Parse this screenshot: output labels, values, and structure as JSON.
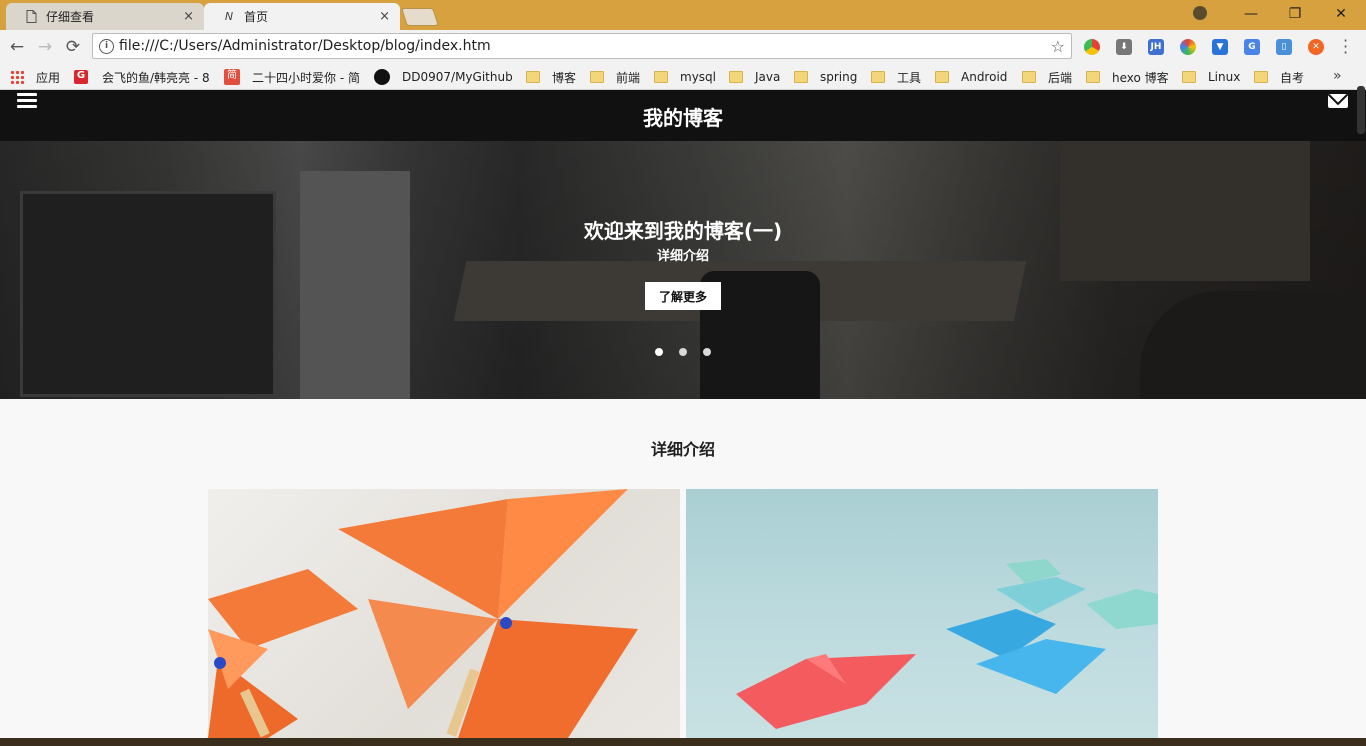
{
  "browser": {
    "tabs": [
      {
        "title": "仔细查看",
        "icon": "page-icon",
        "active": false
      },
      {
        "title": "首页",
        "icon": "n-logo-icon",
        "favicon_text": "N",
        "active": true
      }
    ],
    "tab_close": "×",
    "url": "file:///C:/Users/Administrator/Desktop/blog/index.htm",
    "window_controls": {
      "minimize": "—",
      "restore": "❐",
      "close": "✕"
    },
    "nav": {
      "back": "←",
      "forward": "→",
      "reload": "⟳",
      "info": "i",
      "star": "☆"
    },
    "extensions": [
      {
        "name": "chrome-ext-icon",
        "color": "#e34234",
        "text": ""
      },
      {
        "name": "download-ext-icon",
        "color": "#777777",
        "text": "⬇"
      },
      {
        "name": "jh-ext-icon",
        "color": "#3f6fd1",
        "text": "JH"
      },
      {
        "name": "color-ext-icon",
        "color": "#e0a21f",
        "text": ""
      },
      {
        "name": "pocket-ext-icon",
        "color": "#2a74d9",
        "text": "▼"
      },
      {
        "name": "translate-ext-icon",
        "color": "#4a84e8",
        "text": "G"
      },
      {
        "name": "phone-ext-icon",
        "color": "#4a90d9",
        "text": "▯"
      },
      {
        "name": "orange-ext-icon",
        "color": "#f26522",
        "text": "✕"
      }
    ],
    "bookmarks": [
      {
        "label": "应用",
        "type": "apps"
      },
      {
        "label": "会飞的鱼/韩亮亮 - 8",
        "type": "g",
        "color": "#d7282f",
        "text": "G"
      },
      {
        "label": "二十四小时爱你 - 简",
        "type": "jian",
        "color": "#e34e3e",
        "text": "简"
      },
      {
        "label": "DD0907/MyGithub",
        "type": "github"
      },
      {
        "label": "博客",
        "type": "folder"
      },
      {
        "label": "前端",
        "type": "folder"
      },
      {
        "label": "mysql",
        "type": "folder"
      },
      {
        "label": "Java",
        "type": "folder"
      },
      {
        "label": "spring",
        "type": "folder"
      },
      {
        "label": "工具",
        "type": "folder"
      },
      {
        "label": "Android",
        "type": "folder"
      },
      {
        "label": "后端",
        "type": "folder"
      },
      {
        "label": "hexo 博客",
        "type": "folder"
      },
      {
        "label": "Linux",
        "type": "folder"
      },
      {
        "label": "自考",
        "type": "folder"
      }
    ],
    "more_bookmarks": "»"
  },
  "site": {
    "title": "我的博客",
    "hero": {
      "title": "欢迎来到我的博客(一)",
      "subtitle": "详细介绍",
      "button": "了解更多",
      "slides": 3,
      "active_slide": 0
    },
    "section_title": "详细介绍",
    "cards": [
      {
        "image": "orange-pinwheels-image"
      },
      {
        "image": "paper-boats-image"
      }
    ]
  }
}
